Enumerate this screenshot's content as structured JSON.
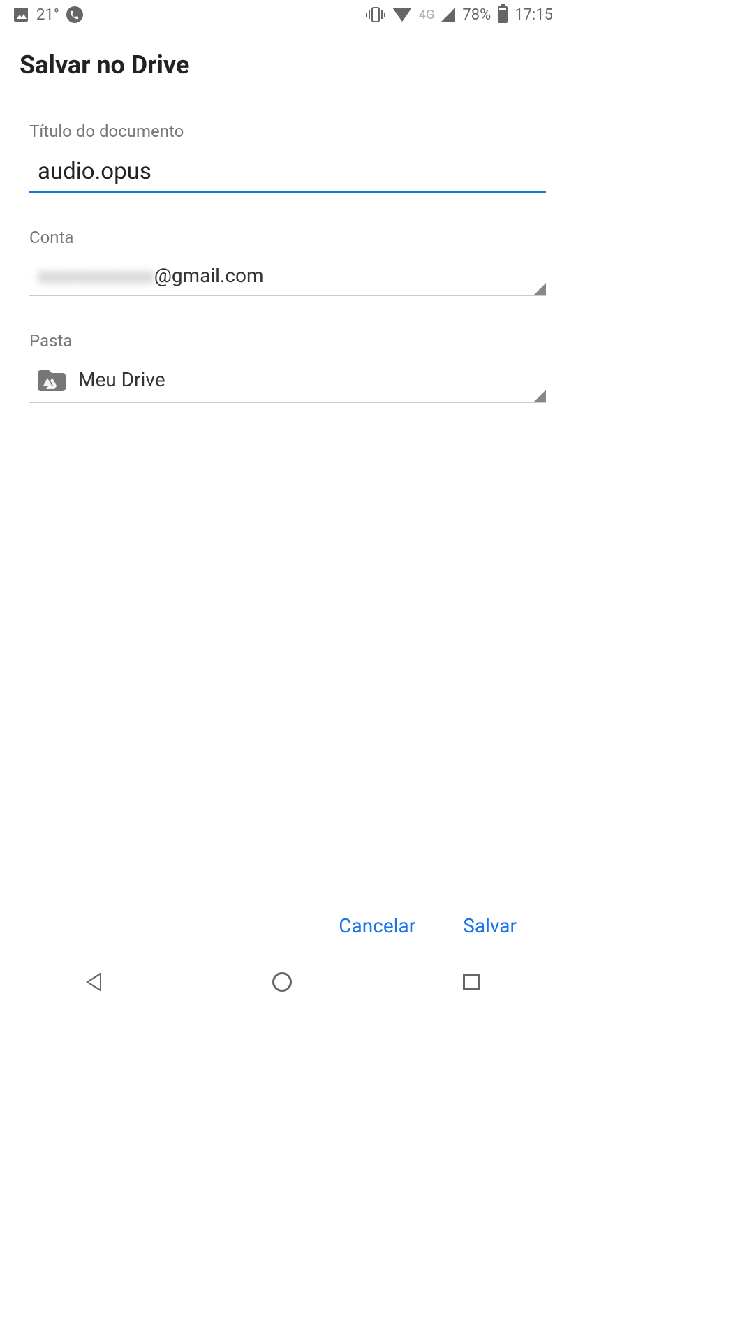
{
  "status_bar": {
    "temperature": "21°",
    "network_type": "4G",
    "battery_percent": "78%",
    "time": "17:15"
  },
  "dialog": {
    "title": "Salvar no Drive",
    "document_title": {
      "label": "Título do documento",
      "value": "audio.opus"
    },
    "account": {
      "label": "Conta",
      "blurred_part": "xxxxxxxxxxxx",
      "visible_part": "@gmail.com"
    },
    "folder": {
      "label": "Pasta",
      "value": "Meu Drive"
    },
    "buttons": {
      "cancel": "Cancelar",
      "save": "Salvar"
    }
  }
}
